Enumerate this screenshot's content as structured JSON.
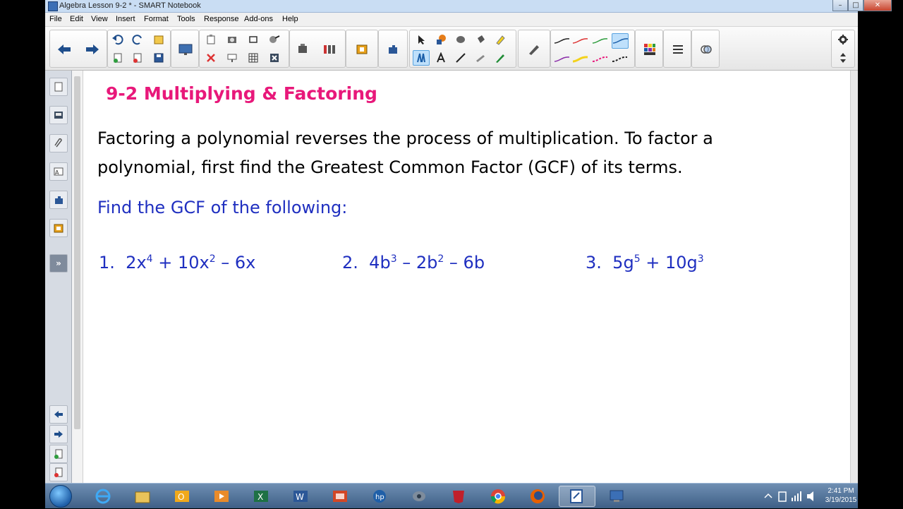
{
  "window": {
    "title": "Algebra Lesson 9-2 * - SMART Notebook",
    "minimize_glyph": "–",
    "maximize_glyph": "□",
    "close_glyph": "✕"
  },
  "menu": [
    "File",
    "Edit",
    "View",
    "Insert",
    "Format",
    "Tools",
    "Response",
    "Add-ons",
    "Help"
  ],
  "toolbar": {
    "icons": [
      "back-arrow-icon",
      "forward-arrow-icon",
      "undo-icon",
      "redo-icon",
      "new-page-icon",
      "delete-page-icon",
      "save-icon",
      "screen-shade-icon",
      "paste-icon",
      "delete-icon",
      "camera-icon",
      "table-icon",
      "full-screen-icon",
      "record-icon",
      "link-icon",
      "insert-icon",
      "select-icon",
      "shapes-icon",
      "eraser-icon",
      "fill-icon",
      "highlighter-icon",
      "creative-pen-icon",
      "text-icon",
      "line-icon",
      "magic-pen-icon",
      "pen-icon",
      "color-palette-icon",
      "line-style-icon",
      "transparency-icon",
      "settings-icon",
      "move-toolbar-icon"
    ]
  },
  "sidebar": {
    "items": [
      "page-sorter-icon",
      "gallery-icon",
      "attachments-icon",
      "properties-icon",
      "add-ons-icon",
      "lesson-activity-icon"
    ],
    "expand_label": "»",
    "bottom_items": [
      "previous-page-icon",
      "next-page-icon",
      "add-page-icon",
      "delete-page-icon"
    ]
  },
  "page": {
    "heading": "9-2 Multiplying & Factoring",
    "paragraph": "Factoring a polynomial reverses the process of multiplication. To factor a polynomial, first find the Greatest Common Factor (GCF) of its terms.",
    "prompt": "Find the GCF of the following:",
    "problems": [
      {
        "num": "1.",
        "parts": [
          "2x",
          "4",
          " + 10x",
          "2",
          " – 6x"
        ]
      },
      {
        "num": "2.",
        "parts": [
          "4b",
          "3",
          " – 2b",
          "2",
          " – 6b"
        ]
      },
      {
        "num": "3.",
        "parts": [
          "5g",
          "5",
          " + 10g",
          "3"
        ]
      }
    ]
  },
  "taskbar": {
    "apps": [
      "internet-explorer-icon",
      "file-explorer-icon",
      "outlook-icon",
      "media-player-icon",
      "excel-icon",
      "word-icon",
      "powerpoint-icon",
      "hp-icon",
      "camera-app-icon",
      "antivirus-icon",
      "chrome-icon",
      "firefox-icon",
      "smart-notebook-icon",
      "remote-desktop-icon"
    ],
    "time": "2:41 PM",
    "date": "3/19/2015"
  },
  "colors": {
    "heading": "#e8187a",
    "prompt": "#1f2fc0",
    "body_text": "#000000"
  }
}
